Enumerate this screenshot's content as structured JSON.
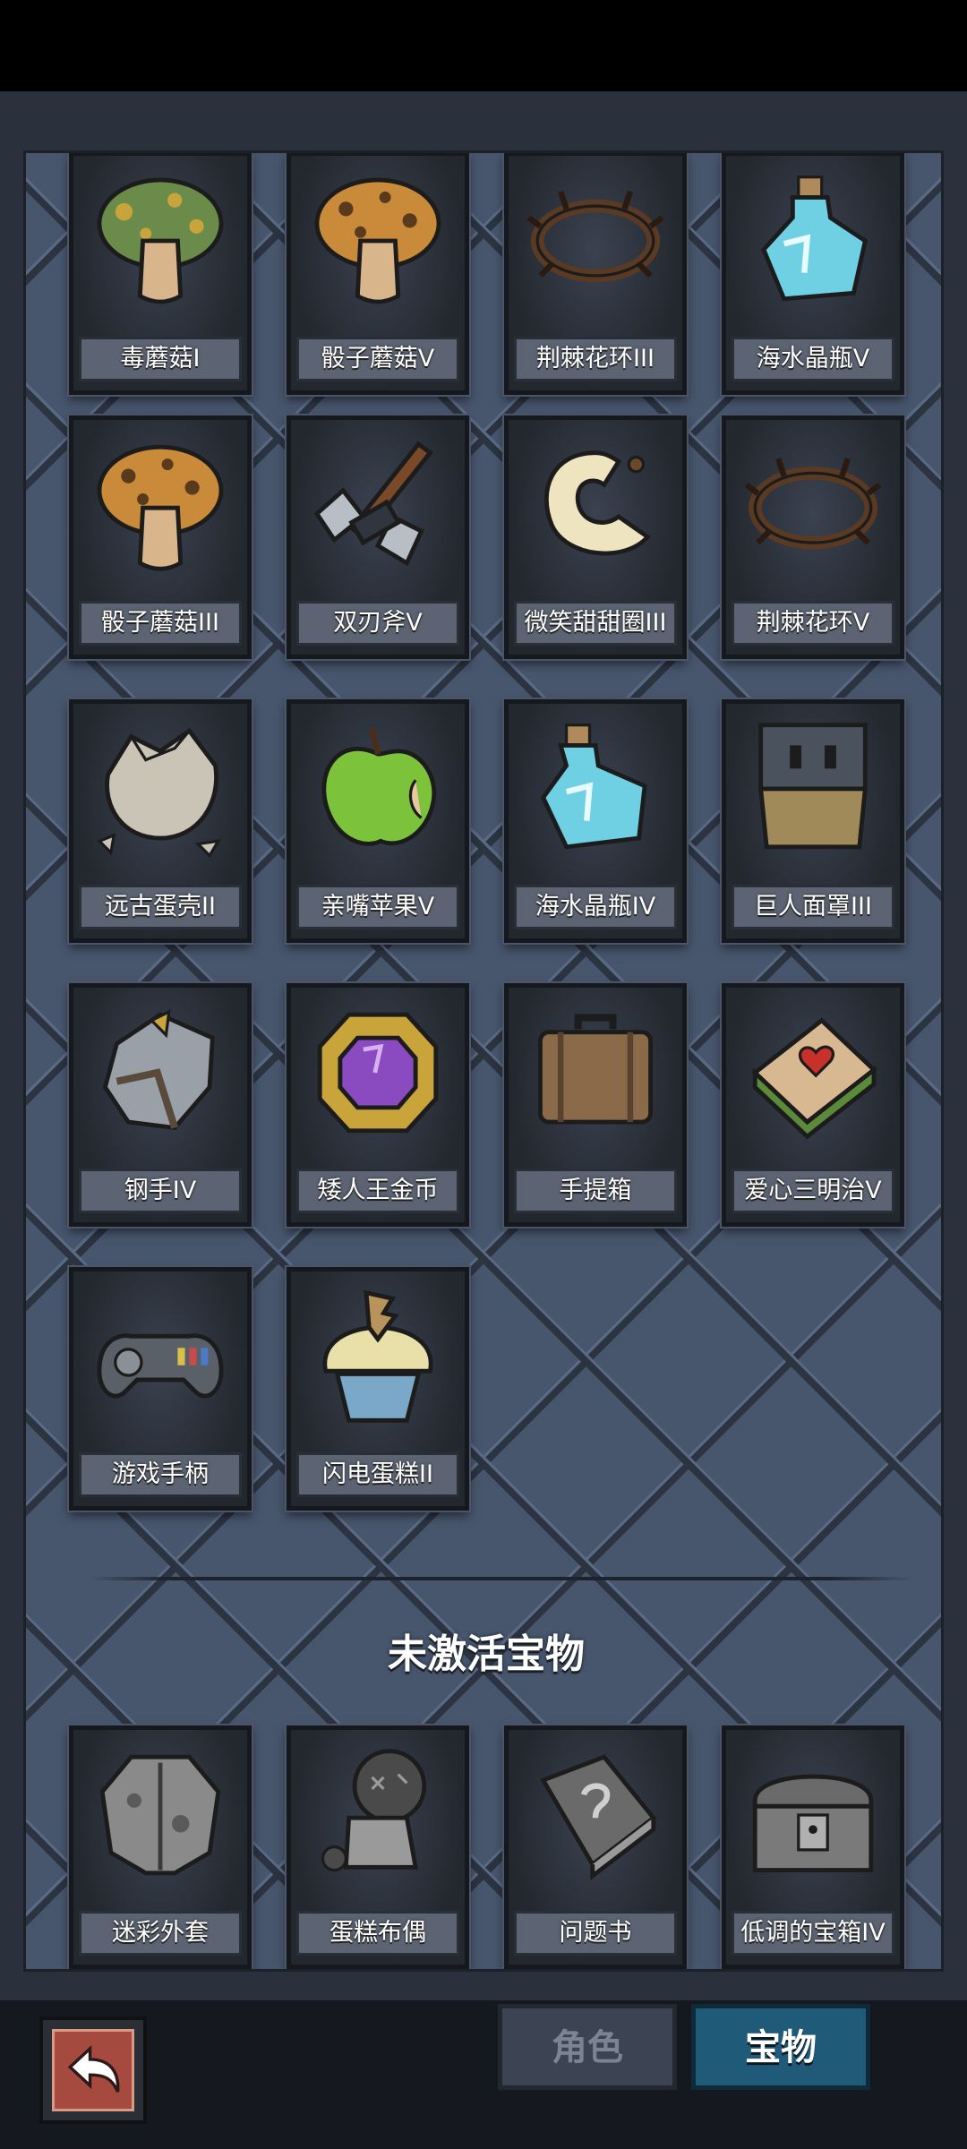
{
  "active_items": [
    {
      "name": "毒蘑菇I",
      "icon": "mushroom-green-icon"
    },
    {
      "name": "骰子蘑菇V",
      "icon": "mushroom-orange-icon"
    },
    {
      "name": "荆棘花环III",
      "icon": "thorn-wreath-icon"
    },
    {
      "name": "海水晶瓶V",
      "icon": "potion-bottle-icon"
    },
    {
      "name": "骰子蘑菇III",
      "icon": "mushroom-orange-icon"
    },
    {
      "name": "双刃斧V",
      "icon": "double-axe-icon"
    },
    {
      "name": "微笑甜甜圈III",
      "icon": "donut-icon"
    },
    {
      "name": "荆棘花环V",
      "icon": "thorn-wreath-icon"
    },
    {
      "name": "远古蛋壳II",
      "icon": "egg-shell-icon"
    },
    {
      "name": "亲嘴苹果V",
      "icon": "apple-icon"
    },
    {
      "name": "海水晶瓶IV",
      "icon": "potion-bottle-icon"
    },
    {
      "name": "巨人面罩III",
      "icon": "giant-mask-icon"
    },
    {
      "name": "钢手IV",
      "icon": "steel-gauntlet-icon"
    },
    {
      "name": "矮人王金币",
      "icon": "gold-coin-icon"
    },
    {
      "name": "手提箱",
      "icon": "suitcase-icon"
    },
    {
      "name": "爱心三明治V",
      "icon": "sandwich-icon"
    },
    {
      "name": "游戏手柄",
      "icon": "gamepad-icon"
    },
    {
      "name": "闪电蛋糕II",
      "icon": "cupcake-icon"
    }
  ],
  "inactive_title": "未激活宝物",
  "inactive_items": [
    {
      "name": "迷彩外套",
      "icon": "jacket-icon"
    },
    {
      "name": "蛋糕布偶",
      "icon": "voodoo-doll-icon"
    },
    {
      "name": "问题书",
      "icon": "question-book-icon"
    },
    {
      "name": "低调的宝箱IV",
      "icon": "treasure-chest-icon"
    }
  ],
  "tabs": {
    "role": "角色",
    "treasure": "宝物"
  }
}
